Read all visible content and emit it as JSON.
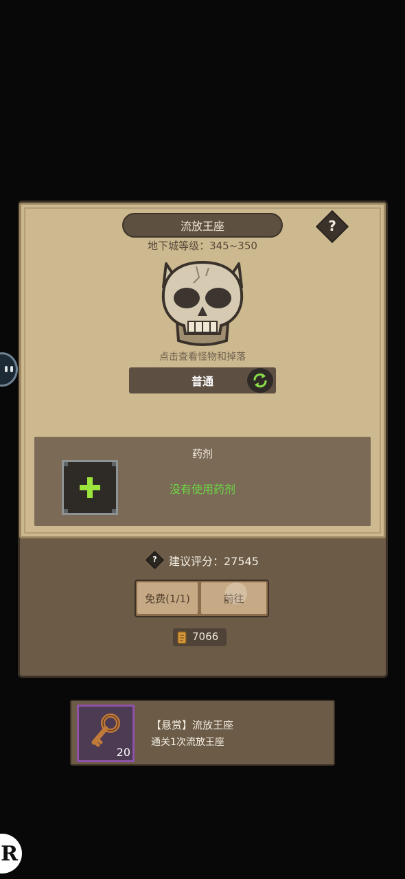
{
  "dungeon": {
    "title": "流放王座",
    "level_label": "地下城等级：345~350",
    "monster_hint": "点击查看怪物和掉落",
    "difficulty": "普通",
    "help_symbol": "?"
  },
  "potion": {
    "section_title": "药剂",
    "empty_text": "没有使用药剂"
  },
  "entry": {
    "score_label": "建议评分：27545",
    "free_button": "免费(1/1)",
    "go_button": "前往",
    "cost_value": "7066"
  },
  "quest": {
    "title": "【悬赏】流放王座",
    "description": "通关1次流放王座",
    "reward_count": "20"
  },
  "corner_logo": "R",
  "colors": {
    "background": "#080808",
    "parchment": "#cdb98f",
    "panel": "#6b5b47",
    "accent_green": "#6cd945",
    "quest_border": "#8f52a8"
  },
  "icons": [
    "skull-icon",
    "refresh-icon",
    "plus-icon",
    "scroll-icon",
    "key-icon",
    "help-icon"
  ]
}
